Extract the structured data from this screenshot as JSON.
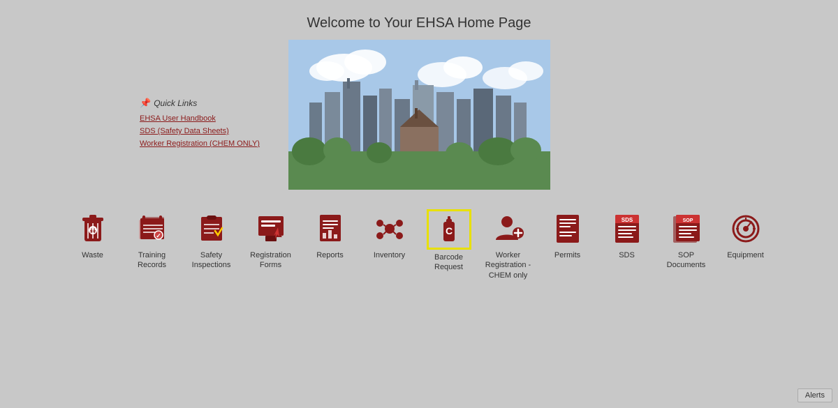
{
  "page": {
    "title": "Welcome to Your EHSA Home Page"
  },
  "quick_links": {
    "title": "Quick Links",
    "items": [
      {
        "label": "EHSA User Handbook",
        "id": "ehsa-handbook"
      },
      {
        "label": "SDS (Safety Data Sheets)",
        "id": "sds-link"
      },
      {
        "label": "Worker Registration (CHEM ONLY)",
        "id": "worker-registration"
      }
    ]
  },
  "icons": [
    {
      "id": "waste",
      "label": "Waste",
      "icon": "waste"
    },
    {
      "id": "training-records",
      "label": "Training Records",
      "icon": "training"
    },
    {
      "id": "safety-inspections",
      "label": "Safety Inspections",
      "icon": "inspection"
    },
    {
      "id": "registration-forms",
      "label": "Registration Forms",
      "icon": "registration"
    },
    {
      "id": "reports",
      "label": "Reports",
      "icon": "reports"
    },
    {
      "id": "inventory",
      "label": "Inventory",
      "icon": "inventory"
    },
    {
      "id": "barcode-request",
      "label": "Barcode Request",
      "icon": "barcode",
      "highlighted": true
    },
    {
      "id": "worker-registration-chem",
      "label": "Worker Registration - CHEM only",
      "icon": "worker"
    },
    {
      "id": "permits",
      "label": "Permits",
      "icon": "permits"
    },
    {
      "id": "sds",
      "label": "SDS",
      "icon": "sds"
    },
    {
      "id": "sop-documents",
      "label": "SOP Documents",
      "icon": "sop"
    },
    {
      "id": "equipment",
      "label": "Equipment",
      "icon": "equipment"
    }
  ],
  "alerts_button": "Alerts"
}
